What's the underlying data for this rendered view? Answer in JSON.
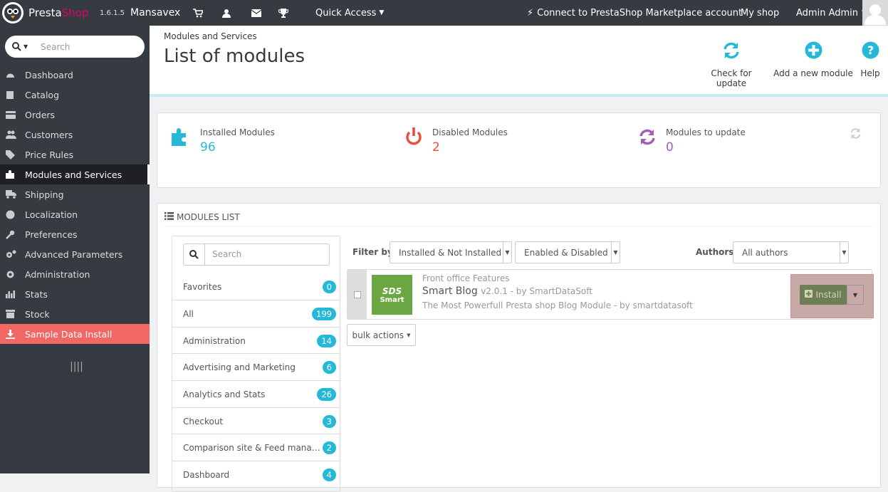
{
  "topbar": {
    "brand_presta": "Presta",
    "brand_shop": "Shop",
    "version": "1.6.1.5",
    "store_name": "Mansavex",
    "quick_access": "Quick Access",
    "connect": "Connect to PrestaShop Marketplace account",
    "my_shop": "My shop",
    "admin": "Admin Admin"
  },
  "sidebar": {
    "search_placeholder": "Search",
    "items": [
      {
        "label": "Dashboard"
      },
      {
        "label": "Catalog"
      },
      {
        "label": "Orders"
      },
      {
        "label": "Customers"
      },
      {
        "label": "Price Rules"
      },
      {
        "label": "Modules and Services"
      },
      {
        "label": "Shipping"
      },
      {
        "label": "Localization"
      },
      {
        "label": "Preferences"
      },
      {
        "label": "Advanced Parameters"
      },
      {
        "label": "Administration"
      },
      {
        "label": "Stats"
      },
      {
        "label": "Stock"
      },
      {
        "label": "Sample Data Install"
      }
    ]
  },
  "header": {
    "breadcrumb": "Modules and Services",
    "title": "List of modules",
    "check_update": "Check for update",
    "add_module": "Add a new module",
    "help": "Help"
  },
  "kpi": {
    "installed_label": "Installed Modules",
    "installed_value": "96",
    "disabled_label": "Disabled Modules",
    "disabled_value": "2",
    "update_label": "Modules to update",
    "update_value": "0"
  },
  "panel": {
    "title": "MODULES LIST",
    "search_placeholder": "Search",
    "filter_by": "Filter by",
    "filter_install": "Installed & Not Installed",
    "filter_enable": "Enabled & Disabled",
    "authors_label": "Authors",
    "authors_value": "All authors",
    "bulk_actions": "bulk actions",
    "categories": [
      {
        "label": "Favorites",
        "count": "0"
      },
      {
        "label": "All",
        "count": "199"
      },
      {
        "label": "Administration",
        "count": "14"
      },
      {
        "label": "Advertising and Marketing",
        "count": "6"
      },
      {
        "label": "Analytics and Stats",
        "count": "26"
      },
      {
        "label": "Checkout",
        "count": "3"
      },
      {
        "label": "Comparison site & Feed mana…",
        "count": "2"
      },
      {
        "label": "Dashboard",
        "count": "4"
      }
    ],
    "module": {
      "category": "Front office Features",
      "name": "Smart Blog",
      "version": "v2.0.1 - by SmartDataSoft",
      "description": "The Most Powerfull Presta shop Blog Module - by smartdatasoft",
      "logo_line1": "SDS",
      "logo_line2": "Smart",
      "install": "Install"
    }
  },
  "colors": {
    "accent": "#25b9d7",
    "sidebar_bg": "#363a41",
    "installed": "#25b9d7",
    "disabled": "#e84e40",
    "update": "#a05fb6",
    "sample_data": "#f26666"
  }
}
